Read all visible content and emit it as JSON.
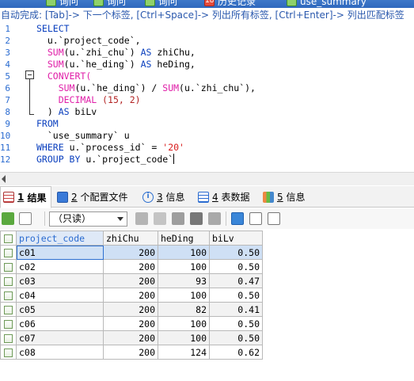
{
  "query_tabs": [
    {
      "label": "询问"
    },
    {
      "label": "询问"
    },
    {
      "label": "询问"
    },
    {
      "label": "历史记录",
      "badge": "18"
    },
    {
      "label": "use_summary"
    }
  ],
  "hint": "自动完成: [Tab]-> 下一个标签, [Ctrl+Space]-> 列出所有标签, [Ctrl+Enter]-> 列出匹配标签",
  "editor": {
    "lines": [
      {
        "n": "1"
      },
      {
        "n": "2"
      },
      {
        "n": "3"
      },
      {
        "n": "4"
      },
      {
        "n": "5"
      },
      {
        "n": "6"
      },
      {
        "n": "7"
      },
      {
        "n": "8"
      },
      {
        "n": "9"
      },
      {
        "n": "10"
      },
      {
        "n": "11"
      },
      {
        "n": "12"
      }
    ],
    "tokens": {
      "select": "SELECT",
      "l2": "u.`project_code`,",
      "sum": "SUM",
      "l3_arg": "(u.`zhi_chu`)",
      "as": "AS",
      "l3_alias": "zhiChu,",
      "l4_arg": "(u.`he_ding`)",
      "l4_alias": "heDing,",
      "convert": "CONVERT(",
      "l6_a": "(u.`he_ding`) / ",
      "l6_b": "(u.`zhi_chu`),",
      "decimal": "DECIMAL",
      "l7_num": "(15, 2)",
      "l8_close": ") ",
      "l8_alias": "biLv",
      "from": "FROM",
      "l10": "`use_summary` u",
      "where": "WHERE",
      "l11": "u.`process_id` = ",
      "l11_str": "'20'",
      "group_by": "GROUP BY",
      "l12": "u.`project_code`"
    }
  },
  "result_tabs": [
    {
      "num": "1",
      "label": "结果",
      "icon": "result-grid-icon",
      "active": true
    },
    {
      "num": "2",
      "label": "个配置文件",
      "icon": "profile-icon"
    },
    {
      "num": "3",
      "label": "信息",
      "icon": "info-icon"
    },
    {
      "num": "4",
      "label": "表数据",
      "icon": "table-data-icon"
    },
    {
      "num": "5",
      "label": "信息",
      "icon": "info-history-icon"
    }
  ],
  "toolbar": {
    "mode_select": "（只读）"
  },
  "grid": {
    "columns": [
      "project_code",
      "zhiChu",
      "heDing",
      "biLv"
    ],
    "rows": [
      [
        "c01",
        "200",
        "100",
        "0.50"
      ],
      [
        "c02",
        "200",
        "100",
        "0.50"
      ],
      [
        "c03",
        "200",
        "93",
        "0.47"
      ],
      [
        "c04",
        "200",
        "100",
        "0.50"
      ],
      [
        "c05",
        "200",
        "82",
        "0.41"
      ],
      [
        "c06",
        "200",
        "100",
        "0.50"
      ],
      [
        "c07",
        "200",
        "100",
        "0.50"
      ],
      [
        "c08",
        "200",
        "124",
        "0.62"
      ]
    ]
  }
}
